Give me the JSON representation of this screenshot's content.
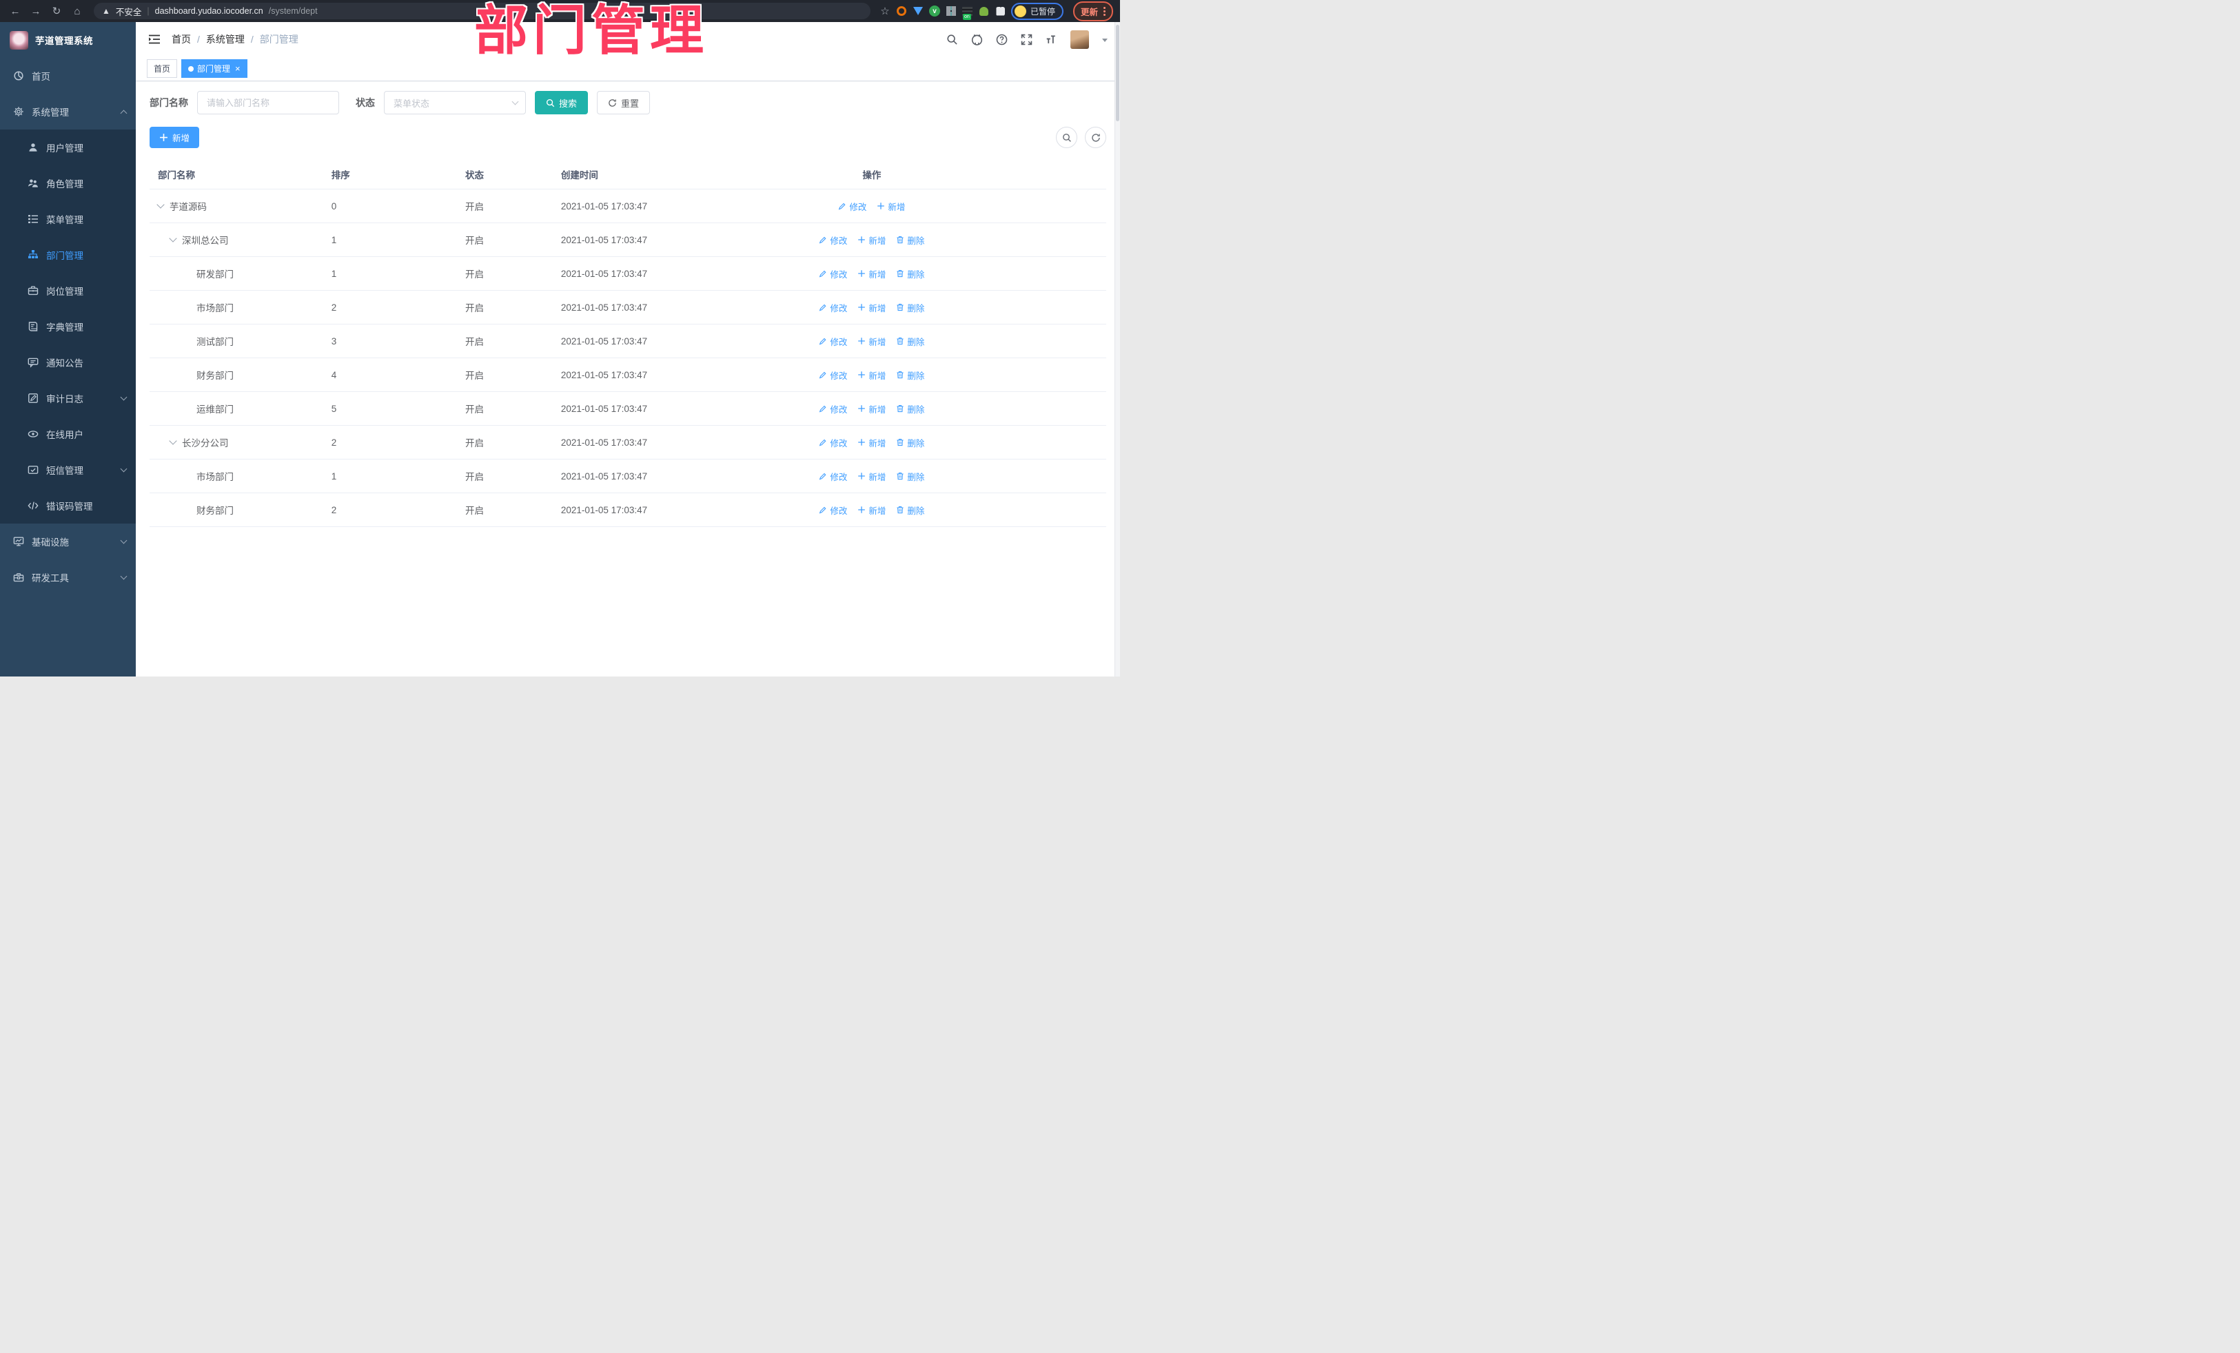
{
  "browser": {
    "security_label": "不安全",
    "url_host": "dashboard.yudao.iocoder.cn",
    "url_path": "/system/dept",
    "url_separator": "|",
    "adblock_badge": "on",
    "paused_label": "已暂停",
    "update_label": "更新",
    "nav_icons": [
      "back-arrow",
      "forward-arrow",
      "reload",
      "home"
    ],
    "extension_icons": [
      "bookmark-star",
      "orange-ring-extension",
      "blue-gem-extension",
      "green-check-extension",
      "grid-extension",
      "adblock-extension",
      "green-person-extension",
      "puzzle-extension"
    ]
  },
  "annotation": {
    "text": "部门管理",
    "color": "#fb3c5f"
  },
  "sidebar": {
    "title": "芋道管理系统",
    "items": [
      {
        "id": "home",
        "label": "首页",
        "icon": "dashboard-icon",
        "sub": false,
        "active": false,
        "chevron": null
      },
      {
        "id": "system-management",
        "label": "系统管理",
        "icon": "gear-icon",
        "sub": false,
        "active": false,
        "chevron": "up"
      },
      {
        "id": "user-management",
        "label": "用户管理",
        "icon": "user-icon",
        "sub": true,
        "active": false,
        "chevron": null
      },
      {
        "id": "role-management",
        "label": "角色管理",
        "icon": "roles-icon",
        "sub": true,
        "active": false,
        "chevron": null
      },
      {
        "id": "menu-management",
        "label": "菜单管理",
        "icon": "menu-list-icon",
        "sub": true,
        "active": false,
        "chevron": null
      },
      {
        "id": "dept-management",
        "label": "部门管理",
        "icon": "org-tree-icon",
        "sub": true,
        "active": true,
        "chevron": null
      },
      {
        "id": "post-management",
        "label": "岗位管理",
        "icon": "post-icon",
        "sub": true,
        "active": false,
        "chevron": null
      },
      {
        "id": "dict-management",
        "label": "字典管理",
        "icon": "dict-icon",
        "sub": true,
        "active": false,
        "chevron": null
      },
      {
        "id": "notice-announcement",
        "label": "通知公告",
        "icon": "announcement-icon",
        "sub": true,
        "active": false,
        "chevron": null
      },
      {
        "id": "audit-log",
        "label": "审计日志",
        "icon": "audit-log-icon",
        "sub": true,
        "active": false,
        "chevron": "down"
      },
      {
        "id": "online-user",
        "label": "在线用户",
        "icon": "online-user-icon",
        "sub": true,
        "active": false,
        "chevron": null
      },
      {
        "id": "sms-management",
        "label": "短信管理",
        "icon": "sms-icon",
        "sub": true,
        "active": false,
        "chevron": "down"
      },
      {
        "id": "error-code-management",
        "label": "错误码管理",
        "icon": "error-code-icon",
        "sub": true,
        "active": false,
        "chevron": null
      },
      {
        "id": "infrastructure",
        "label": "基础设施",
        "icon": "infra-icon",
        "sub": false,
        "active": false,
        "chevron": "down"
      },
      {
        "id": "dev-tools",
        "label": "研发工具",
        "icon": "devtools-icon",
        "sub": false,
        "active": false,
        "chevron": "down"
      }
    ]
  },
  "header": {
    "breadcrumb": [
      "首页",
      "系统管理",
      "部门管理"
    ],
    "separator": "/",
    "tool_icons": [
      "search-icon",
      "github-icon",
      "help-icon",
      "fullscreen-icon",
      "font-size-icon",
      "avatar",
      "caret-down-icon"
    ]
  },
  "tabs": [
    {
      "label": "首页",
      "active": false
    },
    {
      "label": "部门管理",
      "active": true,
      "closable": true
    }
  ],
  "filter": {
    "name_label": "部门名称",
    "name_placeholder": "请输入部门名称",
    "status_label": "状态",
    "status_placeholder": "菜单状态",
    "search_label": "搜索",
    "reset_label": "重置"
  },
  "toolbar": {
    "add_label": "新增"
  },
  "table": {
    "columns": [
      "部门名称",
      "排序",
      "状态",
      "创建时间",
      "操作"
    ],
    "action_labels": {
      "edit": "修改",
      "add": "新增",
      "delete": "删除"
    },
    "rows": [
      {
        "name": "芋道源码",
        "level": 0,
        "has_arrow": true,
        "sort": "0",
        "status": "开启",
        "time": "2021-01-05 17:03:47",
        "actions": [
          "edit",
          "add"
        ]
      },
      {
        "name": "深圳总公司",
        "level": 1,
        "has_arrow": true,
        "sort": "1",
        "status": "开启",
        "time": "2021-01-05 17:03:47",
        "actions": [
          "edit",
          "add",
          "delete"
        ]
      },
      {
        "name": "研发部门",
        "level": 2,
        "has_arrow": false,
        "sort": "1",
        "status": "开启",
        "time": "2021-01-05 17:03:47",
        "actions": [
          "edit",
          "add",
          "delete"
        ]
      },
      {
        "name": "市场部门",
        "level": 2,
        "has_arrow": false,
        "sort": "2",
        "status": "开启",
        "time": "2021-01-05 17:03:47",
        "actions": [
          "edit",
          "add",
          "delete"
        ]
      },
      {
        "name": "测试部门",
        "level": 2,
        "has_arrow": false,
        "sort": "3",
        "status": "开启",
        "time": "2021-01-05 17:03:47",
        "actions": [
          "edit",
          "add",
          "delete"
        ]
      },
      {
        "name": "财务部门",
        "level": 2,
        "has_arrow": false,
        "sort": "4",
        "status": "开启",
        "time": "2021-01-05 17:03:47",
        "actions": [
          "edit",
          "add",
          "delete"
        ]
      },
      {
        "name": "运维部门",
        "level": 2,
        "has_arrow": false,
        "sort": "5",
        "status": "开启",
        "time": "2021-01-05 17:03:47",
        "actions": [
          "edit",
          "add",
          "delete"
        ]
      },
      {
        "name": "长沙分公司",
        "level": 1,
        "has_arrow": true,
        "sort": "2",
        "status": "开启",
        "time": "2021-01-05 17:03:47",
        "actions": [
          "edit",
          "add",
          "delete"
        ]
      },
      {
        "name": "市场部门",
        "level": 2,
        "has_arrow": false,
        "sort": "1",
        "status": "开启",
        "time": "2021-01-05 17:03:47",
        "actions": [
          "edit",
          "add",
          "delete"
        ]
      },
      {
        "name": "财务部门",
        "level": 2,
        "has_arrow": false,
        "sort": "2",
        "status": "开启",
        "time": "2021-01-05 17:03:47",
        "actions": [
          "edit",
          "add",
          "delete"
        ]
      }
    ]
  },
  "colors": {
    "accent_blue": "#409eff",
    "teal_button": "#20b2aa",
    "sidebar_bg": "#2c4760",
    "submenu_bg": "#1f3449",
    "annotation_pink": "#fb3c5f",
    "tab_border": "#d8dce5",
    "row_border": "#ebeef5"
  }
}
